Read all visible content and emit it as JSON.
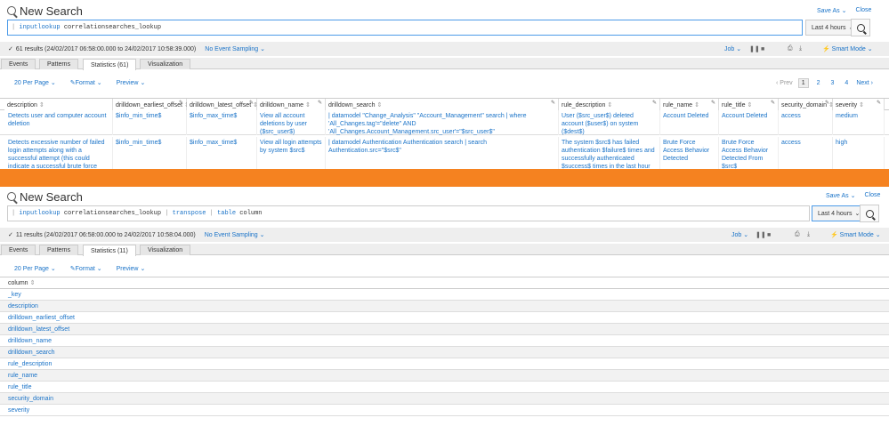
{
  "top": {
    "title": "New Search",
    "save_as": "Save As",
    "close": "Close",
    "query": {
      "kw": "inputlookup",
      "rest": " correlationsearches_lookup"
    },
    "time": "Last 4 hours",
    "results_info": "61 results (24/02/2017 06:58:00.000 to 24/02/2017 10:58:39.000)",
    "sampling": "No Event Sampling",
    "job": "Job",
    "smart_mode": "Smart Mode",
    "tabs": [
      "Events",
      "Patterns",
      "Statistics (61)",
      "Visualization"
    ],
    "options": {
      "per_page": "20 Per Page",
      "format": "Format",
      "preview": "Preview"
    },
    "pager": {
      "prev": "Prev",
      "pages": [
        "1",
        "2",
        "3",
        "4"
      ],
      "next": "Next"
    },
    "columns": [
      "description",
      "drilldown_earliest_offset",
      "drilldown_latest_offset",
      "drilldown_name",
      "drilldown_search",
      "rule_description",
      "rule_name",
      "rule_title",
      "security_domain",
      "severity"
    ],
    "rows": [
      [
        "Detects user and computer account deletion",
        "$info_min_time$",
        "$info_max_time$",
        "View all account deletions by user ($src_user$)",
        "| datamodel \"Change_Analysis\" \"Account_Management\" search | where 'All_Changes.tag'=\"delete\" AND 'All_Changes.Account_Management.src_user'=\"$src_user$\"",
        "User ($src_user$) deleted account ($user$) on system ($dest$)",
        "Account Deleted",
        "Account Deleted",
        "access",
        "medium"
      ],
      [
        "Detects excessive number of failed login attempts along with a successful attempt (this could indicate a successful brute force attack)",
        "$info_min_time$",
        "$info_max_time$",
        "View all login attempts by system $src$",
        "| datamodel Authentication Authentication search | search Authentication.src=\"$src$\"",
        "The system $src$ has failed authentication $failure$ times and successfully authenticated $success$ times in the last hour",
        "Brute Force Access Behavior Detected",
        "Brute Force Access Behavior Detected From $src$",
        "access",
        "high"
      ]
    ]
  },
  "bottom": {
    "title": "New Search",
    "save_as": "Save As",
    "close": "Close",
    "query": {
      "kw1": "inputlookup",
      "rest1": " correlationsearches_lookup ",
      "pipe1": "|",
      "kw2": " transpose ",
      "pipe2": "|",
      "kw3": " table",
      "rest3": " column"
    },
    "time": "Last 4 hours",
    "results_info": "11 results (24/02/2017 06:58:00.000 to 24/02/2017 10:58:04.000)",
    "sampling": "No Event Sampling",
    "job": "Job",
    "smart_mode": "Smart Mode",
    "tabs": [
      "Events",
      "Patterns",
      "Statistics (11)",
      "Visualization"
    ],
    "options": {
      "per_page": "20 Per Page",
      "format": "Format",
      "preview": "Preview"
    },
    "column_header": "column",
    "values": [
      "_key",
      "description",
      "drilldown_earliest_offset",
      "drilldown_latest_offset",
      "drilldown_name",
      "drilldown_search",
      "rule_description",
      "rule_name",
      "rule_title",
      "security_domain",
      "severity"
    ]
  },
  "colors": {
    "accent": "#1a73c8",
    "divider": "#f58220",
    "search_border": "#4c9be8",
    "bar_bg": "#eeeeee"
  }
}
